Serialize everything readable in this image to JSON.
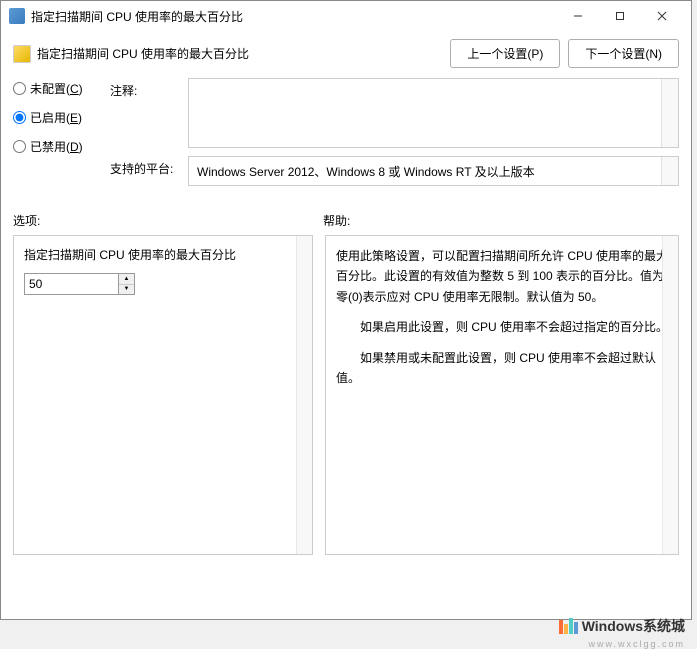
{
  "titlebar": {
    "title": "指定扫描期间 CPU 使用率的最大百分比"
  },
  "header": {
    "title": "指定扫描期间 CPU 使用率的最大百分比",
    "prev_btn": "上一个设置(P)",
    "next_btn": "下一个设置(N)"
  },
  "radio": {
    "not_configured": "未配置(C)",
    "enabled": "已启用(E)",
    "disabled": "已禁用(D)",
    "selected": "enabled"
  },
  "fields": {
    "comment_label": "注释:",
    "platform_label": "支持的平台:",
    "platform_value": "Windows Server 2012、Windows 8 或 Windows RT 及以上版本"
  },
  "sections": {
    "options_label": "选项:",
    "help_label": "帮助:"
  },
  "options": {
    "label": "指定扫描期间 CPU 使用率的最大百分比",
    "value": "50"
  },
  "help": {
    "p1": "使用此策略设置，可以配置扫描期间所允许 CPU 使用率的最大百分比。此设置的有效值为整数 5 到 100 表示的百分比。值为零(0)表示应对 CPU 使用率无限制。默认值为 50。",
    "p2": "如果启用此设置，则 CPU 使用率不会超过指定的百分比。",
    "p3": "如果禁用或未配置此设置，则 CPU 使用率不会超过默认值。"
  },
  "watermark": {
    "text": "Windows系统城",
    "url": "www.wxclgg.com"
  }
}
